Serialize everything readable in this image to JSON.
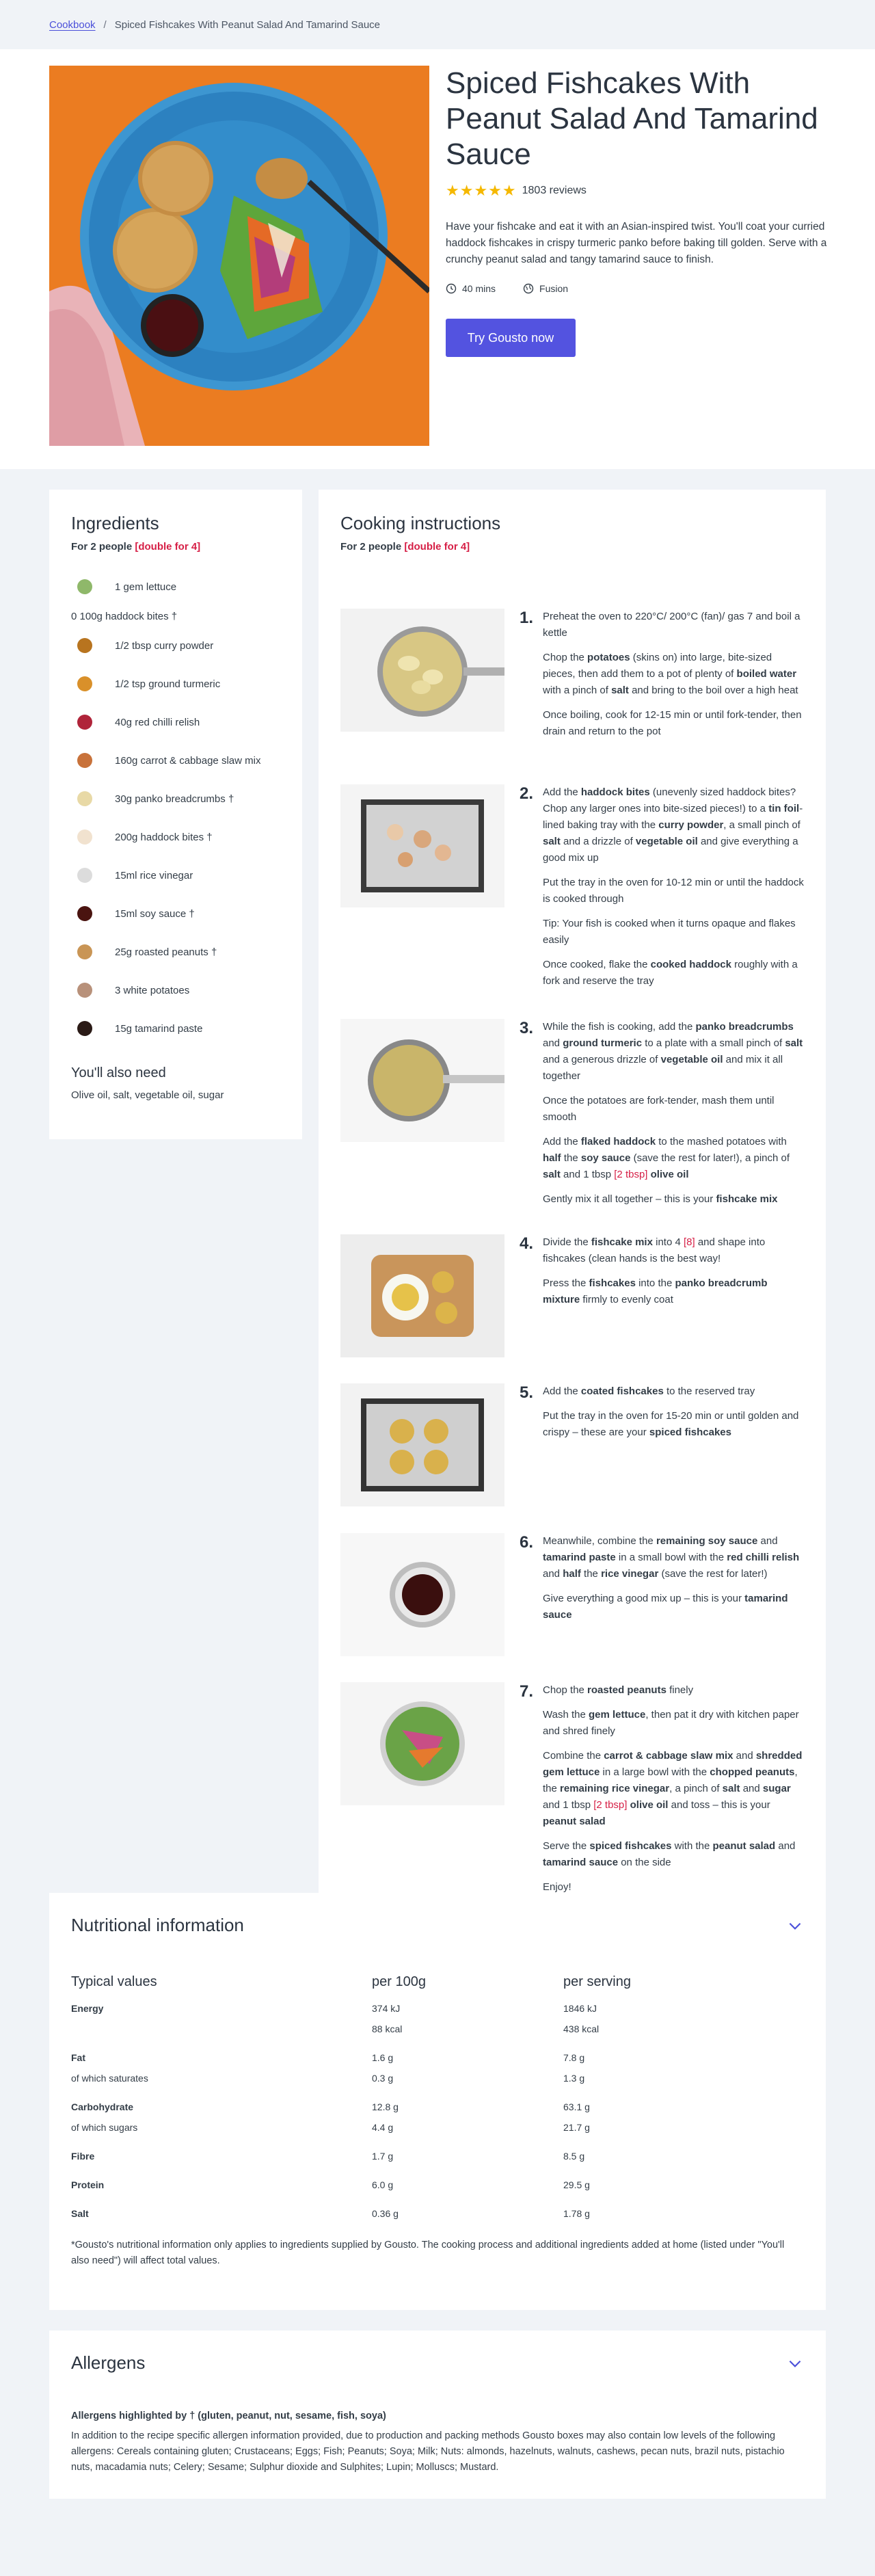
{
  "breadcrumb": {
    "root": "Cookbook",
    "separator": "/",
    "current": "Spiced Fishcakes With Peanut Salad And Tamarind Sauce"
  },
  "recipe": {
    "title": "Spiced Fishcakes With Peanut Salad And Tamarind Sauce",
    "rating_stars": 5,
    "reviews": "1803 reviews",
    "description": "Have your fishcake and eat it with an Asian-inspired twist. You'll coat your curried haddock fishcakes in crispy turmeric panko before baking till golden. Serve with a crunchy peanut salad and tangy tamarind sauce to finish.",
    "time": "40 mins",
    "cuisine": "Fusion",
    "cta": "Try Gousto now"
  },
  "ingredients": {
    "title": "Ingredients",
    "for_people": "For 2 people",
    "double_link": "[double for 4]",
    "items": [
      {
        "text": "1 gem lettuce",
        "icon": "lettuce-icon",
        "color": "#8fb86a"
      },
      {
        "text": "0 100g haddock bites †",
        "icon": "none",
        "color": ""
      },
      {
        "text": "1/2 tbsp curry powder",
        "icon": "spice-icon",
        "color": "#b8741f"
      },
      {
        "text": "1/2 tsp ground turmeric",
        "icon": "spice-icon",
        "color": "#d9902a"
      },
      {
        "text": "40g red chilli relish",
        "icon": "relish-icon",
        "color": "#b0243a"
      },
      {
        "text": "160g carrot & cabbage slaw mix",
        "icon": "slaw-icon",
        "color": "#c8723a"
      },
      {
        "text": "30g panko breadcrumbs †",
        "icon": "crumbs-icon",
        "color": "#e8d9a6"
      },
      {
        "text": "200g haddock bites †",
        "icon": "fish-icon",
        "color": "#f1e2cf"
      },
      {
        "text": "15ml rice vinegar",
        "icon": "vinegar-icon",
        "color": "#dcdcdc"
      },
      {
        "text": "15ml soy sauce †",
        "icon": "soy-icon",
        "color": "#4a1410"
      },
      {
        "text": "25g roasted peanuts †",
        "icon": "peanut-icon",
        "color": "#c99555"
      },
      {
        "text": "3 white potatoes",
        "icon": "potato-icon",
        "color": "#b8917a"
      },
      {
        "text": "15g tamarind paste",
        "icon": "tamarind-icon",
        "color": "#2a1a16"
      }
    ],
    "also_title": "You'll also need",
    "also_text": "Olive oil, salt, vegetable oil, sugar"
  },
  "instructions": {
    "title": "Cooking instructions",
    "for_people": "For 2 people",
    "double_link": "[double for 4]",
    "steps": [
      {
        "num": "1.",
        "image": "potatoes-pan-image",
        "paras": [
          "Preheat the oven to 220°C/ 200°C (fan)/ gas 7 and boil a kettle",
          "Chop the **potatoes** (skins on) into large, bite-sized pieces, then add them to a pot of plenty of **boiled water** with a pinch of **salt** and bring to the boil over a high heat",
          "Once boiling, cook for 12-15 min or until fork-tender, then drain and return to the pot"
        ]
      },
      {
        "num": "2.",
        "image": "haddock-tray-image",
        "paras": [
          "Add the **haddock bites** (unevenly sized haddock bites? Chop any larger ones into bite-sized pieces!) to a **tin foil**-lined baking tray with the **curry powder**, a small pinch of **salt** and a drizzle of **vegetable oil** and give everything a good mix up",
          "Put the tray in the oven for 10-12 min or until the haddock is cooked through",
          "Tip: Your fish is cooked when it turns opaque and flakes easily",
          "Once cooked, flake the **cooked haddock** roughly with a fork and reserve the tray"
        ]
      },
      {
        "num": "3.",
        "image": "mash-pan-image",
        "paras": [
          "While the fish is cooking, add the **panko breadcrumbs** and **ground turmeric** to a plate with a small pinch of **salt** and a generous drizzle of **vegetable oil** and mix it all together",
          "Once the potatoes are fork-tender, mash them until smooth",
          "Add the **flaked haddock** to the mashed potatoes with **half** the **soy sauce** (save the rest for later!), a pinch of **salt** and 1 tbsp {{[2 tbsp]}} **olive oil**",
          "Gently mix it all together – this is your **fishcake mix**"
        ]
      },
      {
        "num": "4.",
        "image": "shaping-fishcakes-image",
        "paras": [
          "Divide the **fishcake mix** into 4 {{[8]}} and shape into fishcakes (clean hands is the best way!",
          "Press the **fishcakes** into the **panko breadcrumb mixture** firmly to evenly coat"
        ]
      },
      {
        "num": "5.",
        "image": "fishcakes-tray-image",
        "paras": [
          "Add the **coated fishcakes** to the reserved tray",
          "Put the tray in the oven for 15-20 min or until golden and crispy – these are your **spiced fishcakes**"
        ]
      },
      {
        "num": "6.",
        "image": "sauce-bowl-image",
        "paras": [
          "Meanwhile, combine the **remaining soy sauce** and **tamarind paste** in a small bowl with the **red chilli relish** and **half** the **rice vinegar** (save the rest for later!)",
          "Give everything a good mix up – this is your **tamarind sauce**"
        ]
      },
      {
        "num": "7.",
        "image": "salad-bowl-image",
        "paras": [
          "Chop the **roasted peanuts** finely",
          "Wash the **gem lettuce**, then pat it dry with kitchen paper and shred finely",
          "Combine the **carrot & cabbage slaw mix** and **shredded gem lettuce** in a large bowl with the **chopped peanuts**, the **remaining rice vinegar**, a pinch of **salt** and **sugar** and 1 tbsp {{[2 tbsp]}} **olive oil** and toss – this is your **peanut salad**",
          "Serve the **spiced fishcakes** with the **peanut salad** and **tamarind sauce** on the side",
          "Enjoy!"
        ]
      }
    ]
  },
  "nutrition": {
    "title": "Nutritional information",
    "headers": [
      "Typical values",
      "per 100g",
      "per serving"
    ],
    "rows": [
      {
        "label": "Energy",
        "bold": true,
        "per100": "374 kJ",
        "serving": "1846 kJ"
      },
      {
        "label": "",
        "bold": false,
        "per100": "88 kcal",
        "serving": "438 kcal"
      },
      {
        "gap": true
      },
      {
        "label": "Fat",
        "bold": true,
        "per100": "1.6 g",
        "serving": "7.8 g"
      },
      {
        "label": "of which saturates",
        "bold": false,
        "per100": "0.3 g",
        "serving": "1.3 g"
      },
      {
        "gap": true
      },
      {
        "label": "Carbohydrate",
        "bold": true,
        "per100": "12.8 g",
        "serving": "63.1 g"
      },
      {
        "label": "of which sugars",
        "bold": false,
        "per100": "4.4 g",
        "serving": "21.7 g"
      },
      {
        "gap": true
      },
      {
        "label": "Fibre",
        "bold": true,
        "per100": "1.7 g",
        "serving": "8.5 g"
      },
      {
        "gap": true
      },
      {
        "label": "Protein",
        "bold": true,
        "per100": "6.0 g",
        "serving": "29.5 g"
      },
      {
        "gap": true
      },
      {
        "label": "Salt",
        "bold": true,
        "per100": "0.36 g",
        "serving": "1.78 g"
      }
    ],
    "note": "*Gousto's nutritional information only applies to ingredients supplied by Gousto. The cooking process and additional ingredients added at home (listed under \"You'll also need\") will affect total values."
  },
  "allergens": {
    "title": "Allergens",
    "highlight": "Allergens highlighted by † (gluten, peanut, nut, sesame, fish, soya)",
    "text": "In addition to the recipe specific allergen information provided, due to production and packing methods Gousto boxes may also contain low levels of the following allergens: Cereals containing gluten; Crustaceans; Eggs; Fish; Peanuts; Soya; Milk; Nuts: almonds, hazelnuts, walnuts, cashews, pecan nuts, brazil nuts, pistachio nuts, macadamia nuts; Celery; Sesame; Sulphur dioxide and Sulphites; Lupin; Molluscs; Mustard."
  },
  "colors": {
    "accent": "#5353e0",
    "link": "#4a4fd9",
    "highlight": "#d61f46",
    "star": "#f5b800"
  }
}
